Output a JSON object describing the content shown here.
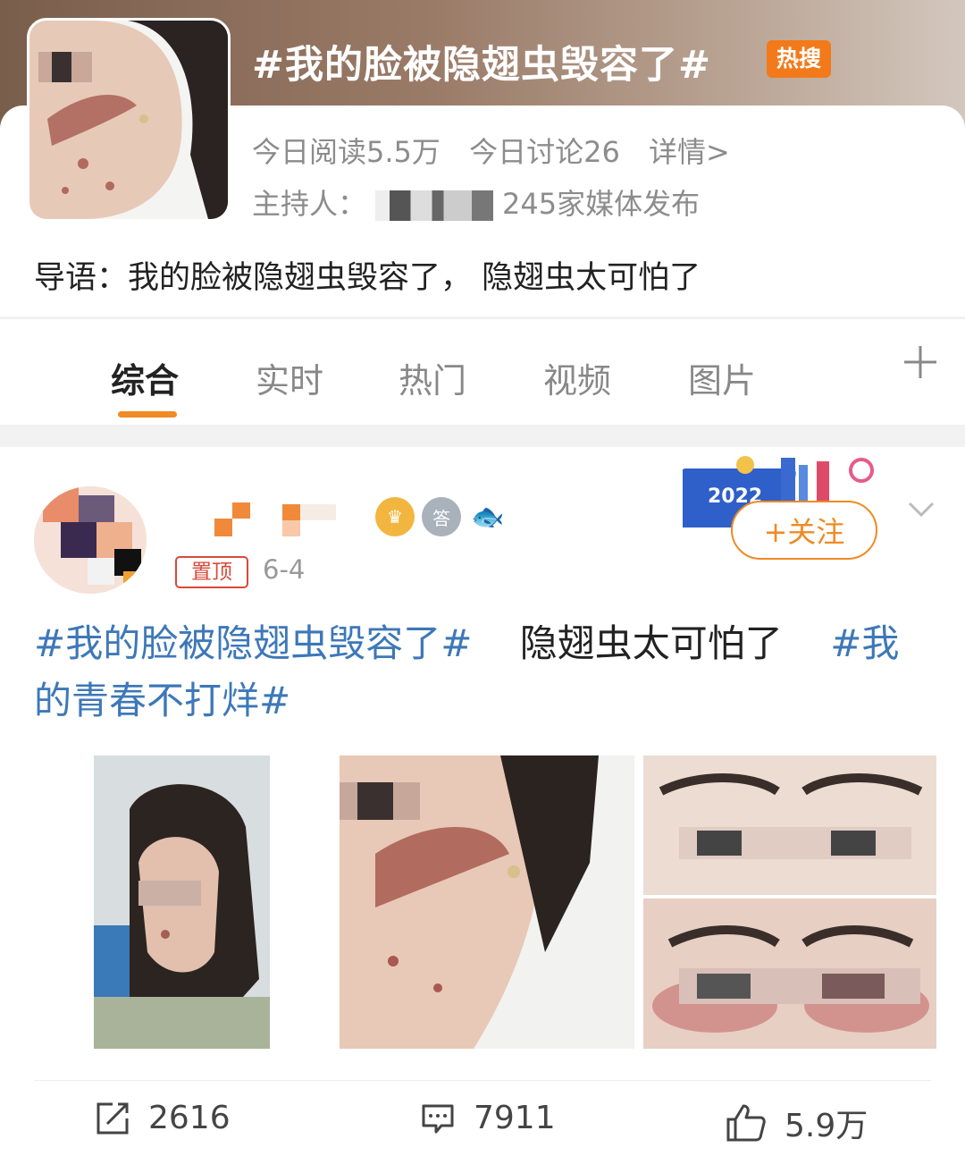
{
  "topic": {
    "title": "#我的脸被隐翅虫毁容了#",
    "hot_badge": "热搜",
    "reads": "今日阅读5.5万",
    "discussions": "今日讨论26",
    "details": "详情>",
    "host_label": "主持人：",
    "media": "245家媒体发布",
    "lead": "导语：我的脸被隐翅虫毁容了， 隐翅虫太可怕了"
  },
  "tabs": [
    "综合",
    "实时",
    "热门",
    "视频",
    "图片"
  ],
  "tab_more_icon": "plus-icon",
  "post": {
    "pin_label": "置顶",
    "date": "6-4",
    "event_year": "2022",
    "follow_label": "+关注",
    "text_tag1": "#我的脸被隐翅虫毁容了#",
    "text_body": "隐翅虫太可怕了",
    "text_tag2": "#我的青春不打烊#",
    "reposts": "2616",
    "comments": "7911",
    "likes": "5.9万"
  },
  "colors": {
    "accent": "#f08a24",
    "link": "#3d78b8",
    "hot_badge": "#f27a1a"
  }
}
